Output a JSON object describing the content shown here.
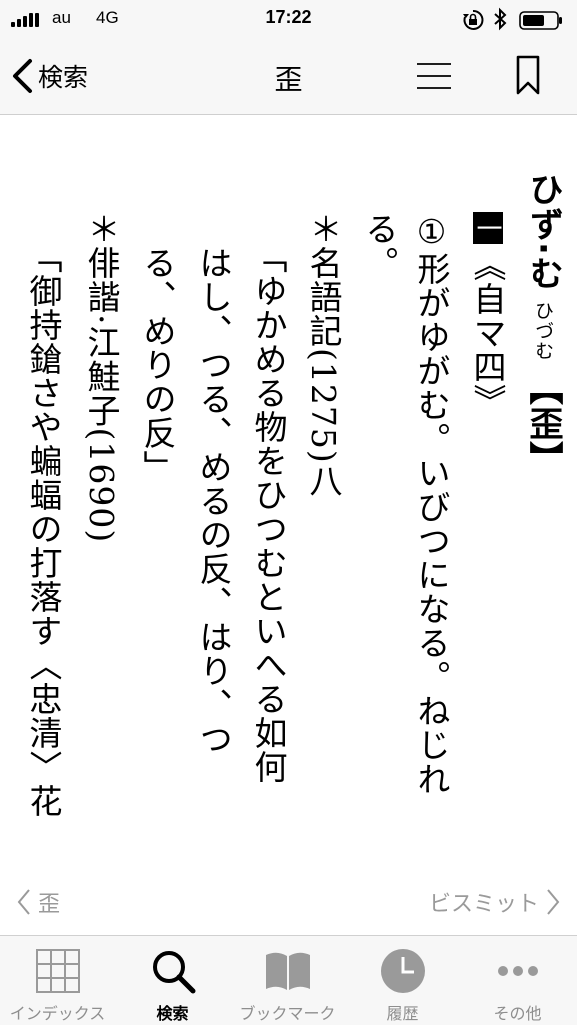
{
  "status_bar": {
    "carrier": "au",
    "network": "4G",
    "time": "17:22"
  },
  "nav": {
    "back_label": "検索",
    "title": "歪"
  },
  "entry": {
    "headword": "ひず·む",
    "reading": "ひづむ",
    "kanji": "【歪】",
    "sense_number": "①",
    "pos_label": "一",
    "pos_text": "《自マ四》",
    "definition": "形がゆがむ。いびつになる。ねじれ",
    "definition_end": "る。",
    "citation1_source": "＊名語記(1275)八",
    "citation1_line1": "「ゆかめる物をひつむといへる如何",
    "citation1_line2": "はし、つる、めるの反、はり、つ",
    "citation1_line3": "る、めりの反」",
    "citation2_source": "＊俳諧·江鮭子(1690)",
    "citation2_line1": "「御持鎗さや蝙蝠の打落す〈忠清〉花"
  },
  "pager": {
    "prev_label": "歪",
    "next_label": "ビスミット"
  },
  "tabs": [
    {
      "label": "インデックス",
      "icon": "grid-icon"
    },
    {
      "label": "検索",
      "icon": "search-icon"
    },
    {
      "label": "ブックマーク",
      "icon": "book-icon"
    },
    {
      "label": "履歴",
      "icon": "clock-icon"
    },
    {
      "label": "その他",
      "icon": "more-icon"
    }
  ],
  "colors": {
    "bar_background": "#f7f7f7",
    "inactive_gray": "#8e8e8e",
    "active": "#000000"
  }
}
